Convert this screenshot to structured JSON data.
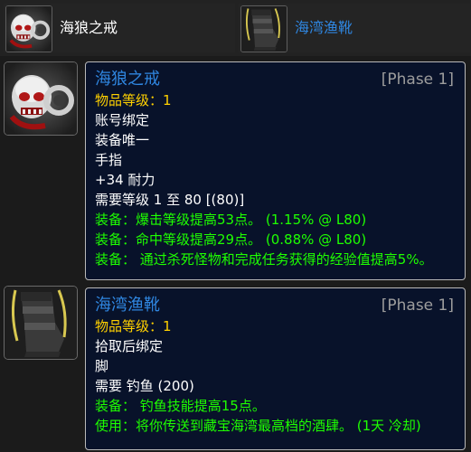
{
  "top_items": [
    {
      "name": "海狼之戒",
      "color": "#ffffff",
      "icon": "skull-ring-icon"
    },
    {
      "name": "海湾渔靴",
      "color": "#2f86e0",
      "icon": "boot-icon"
    }
  ],
  "tooltips": [
    {
      "title": "海狼之戒",
      "title_color": "#2f86e0",
      "phase": "[Phase 1]",
      "icon": "skull-ring-icon",
      "lines": [
        {
          "text": "物品等级：1",
          "color": "#ffd100"
        },
        {
          "text": "账号绑定",
          "color": "#ffffff"
        },
        {
          "text": "装备唯一",
          "color": "#ffffff"
        },
        {
          "text": "手指",
          "color": "#ffffff"
        },
        {
          "text": "+34 耐力",
          "color": "#ffffff"
        },
        {
          "text": "需要等级 1 至 80 [(80)]",
          "color": "#ffffff"
        },
        {
          "text": "装备：爆击等级提高53点。 (1.15% @ L80)",
          "color": "#1eff00"
        },
        {
          "text": "装备：命中等级提高29点。 (0.88% @ L80)",
          "color": "#1eff00"
        },
        {
          "text": "装备： 通过杀死怪物和完成任务获得的经验值提高5%。",
          "color": "#1eff00"
        }
      ]
    },
    {
      "title": "海湾渔靴",
      "title_color": "#2f86e0",
      "phase": "[Phase 1]",
      "icon": "boot-icon",
      "lines": [
        {
          "text": "物品等级：1",
          "color": "#ffd100"
        },
        {
          "text": "拾取后绑定",
          "color": "#ffffff"
        },
        {
          "text": "脚",
          "color": "#ffffff"
        },
        {
          "text": "需要 钓鱼 (200)",
          "color": "#ffffff"
        },
        {
          "text": "装备： 钓鱼技能提高15点。",
          "color": "#1eff00"
        },
        {
          "text": "使用：将你传送到藏宝海湾最高档的酒肆。 (1天 冷却)",
          "color": "#1eff00"
        }
      ]
    }
  ]
}
